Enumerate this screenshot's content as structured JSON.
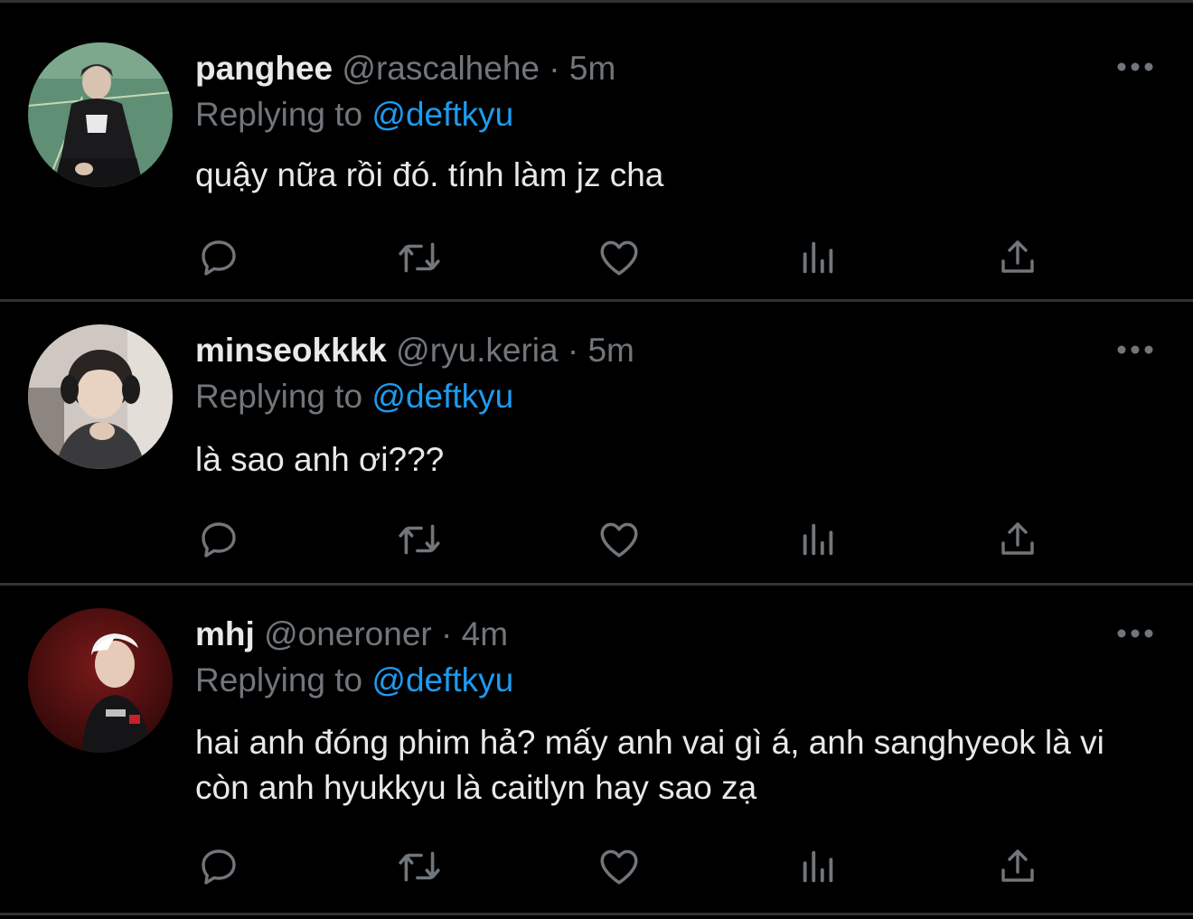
{
  "tweets": [
    {
      "name": "panghee",
      "handle": "@rascalhehe",
      "separator": "·",
      "time": "5m",
      "replying_prefix": "Replying to",
      "replying_to": "@deftkyu",
      "text": "quậy nữa rồi đó. tính làm jz cha"
    },
    {
      "name": "minseokkkk",
      "handle": "@ryu.keria",
      "separator": "·",
      "time": "5m",
      "replying_prefix": "Replying to",
      "replying_to": "@deftkyu",
      "text": "là sao anh ơi???"
    },
    {
      "name": "mhj",
      "handle": "@oneroner",
      "separator": "·",
      "time": "4m",
      "replying_prefix": "Replying to",
      "replying_to": "@deftkyu",
      "text": "hai anh đóng phim hả? mấy anh vai gì á, anh sanghyeok là vi còn anh hyukkyu là caitlyn hay sao zạ"
    }
  ],
  "actions": [
    "reply-icon",
    "retweet-icon",
    "like-icon",
    "views-icon",
    "share-icon"
  ],
  "more_icon": "more-icon",
  "colors": {
    "background": "#000000",
    "primary_text": "#e7e9ea",
    "secondary_text": "#71767b",
    "accent": "#1d9bf0",
    "divider": "#2f3336"
  }
}
